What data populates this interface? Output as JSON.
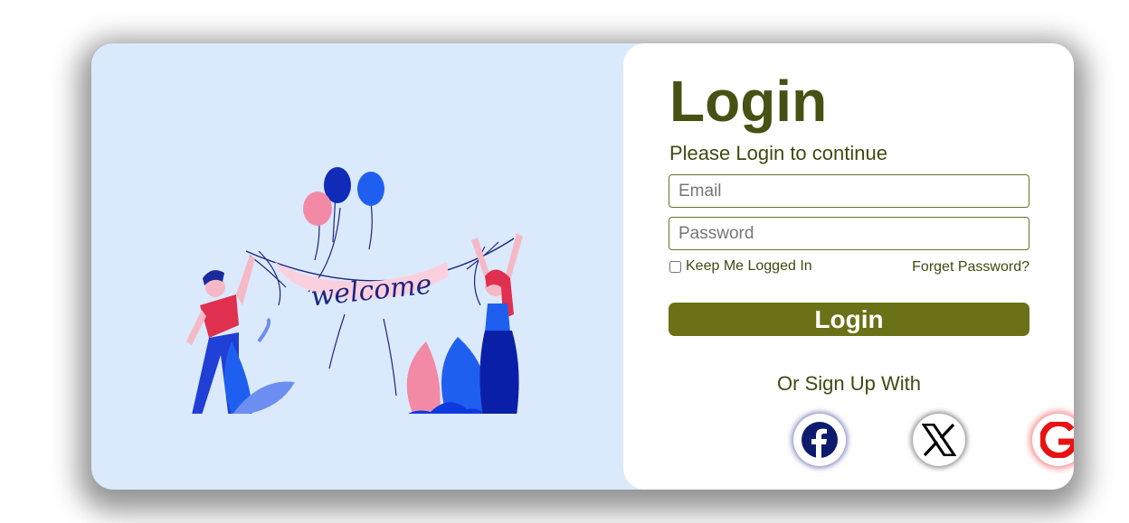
{
  "login": {
    "title": "Login",
    "subtitle": "Please Login to continue",
    "email_placeholder": "Email",
    "password_placeholder": "Password",
    "remember_label": "Keep Me Logged In",
    "forgot_label": "Forget Password?",
    "submit_label": "Login",
    "social_heading": "Or Sign Up With"
  },
  "illustration": {
    "banner_text": "welcome"
  },
  "social": [
    {
      "name": "facebook-icon"
    },
    {
      "name": "x-icon"
    },
    {
      "name": "google-icon"
    }
  ],
  "colors": {
    "accent": "#6a7116",
    "heading": "#475114",
    "illustration_bg": "#dbe9fc",
    "facebook": "#0c1b6e",
    "google": "#e81212"
  }
}
